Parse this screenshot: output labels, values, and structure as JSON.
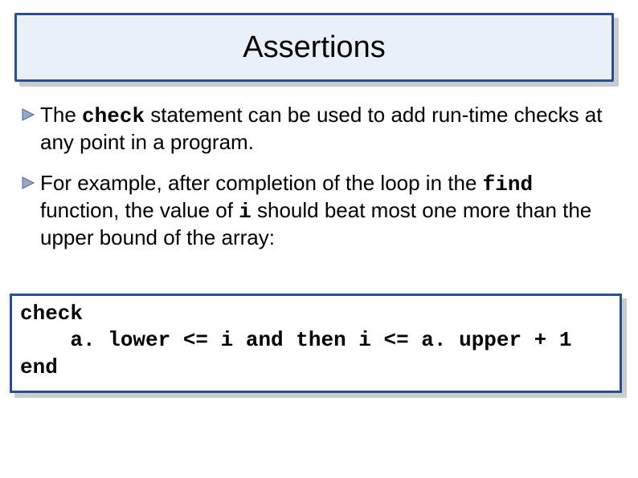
{
  "slide": {
    "title": "Assertions",
    "bullets": [
      {
        "pre": "The ",
        "kw": "check",
        "post": " statement can be used to add run-time checks at any point in a program."
      },
      {
        "pre": "For example, after completion of the loop in the ",
        "kw": "find",
        "mid": " function, the value of ",
        "kw2": "i",
        "post": " should beat most one more than the upper bound of the array:"
      }
    ],
    "code": "check\n    a. lower <= i and then i <= a. upper + 1\nend"
  }
}
